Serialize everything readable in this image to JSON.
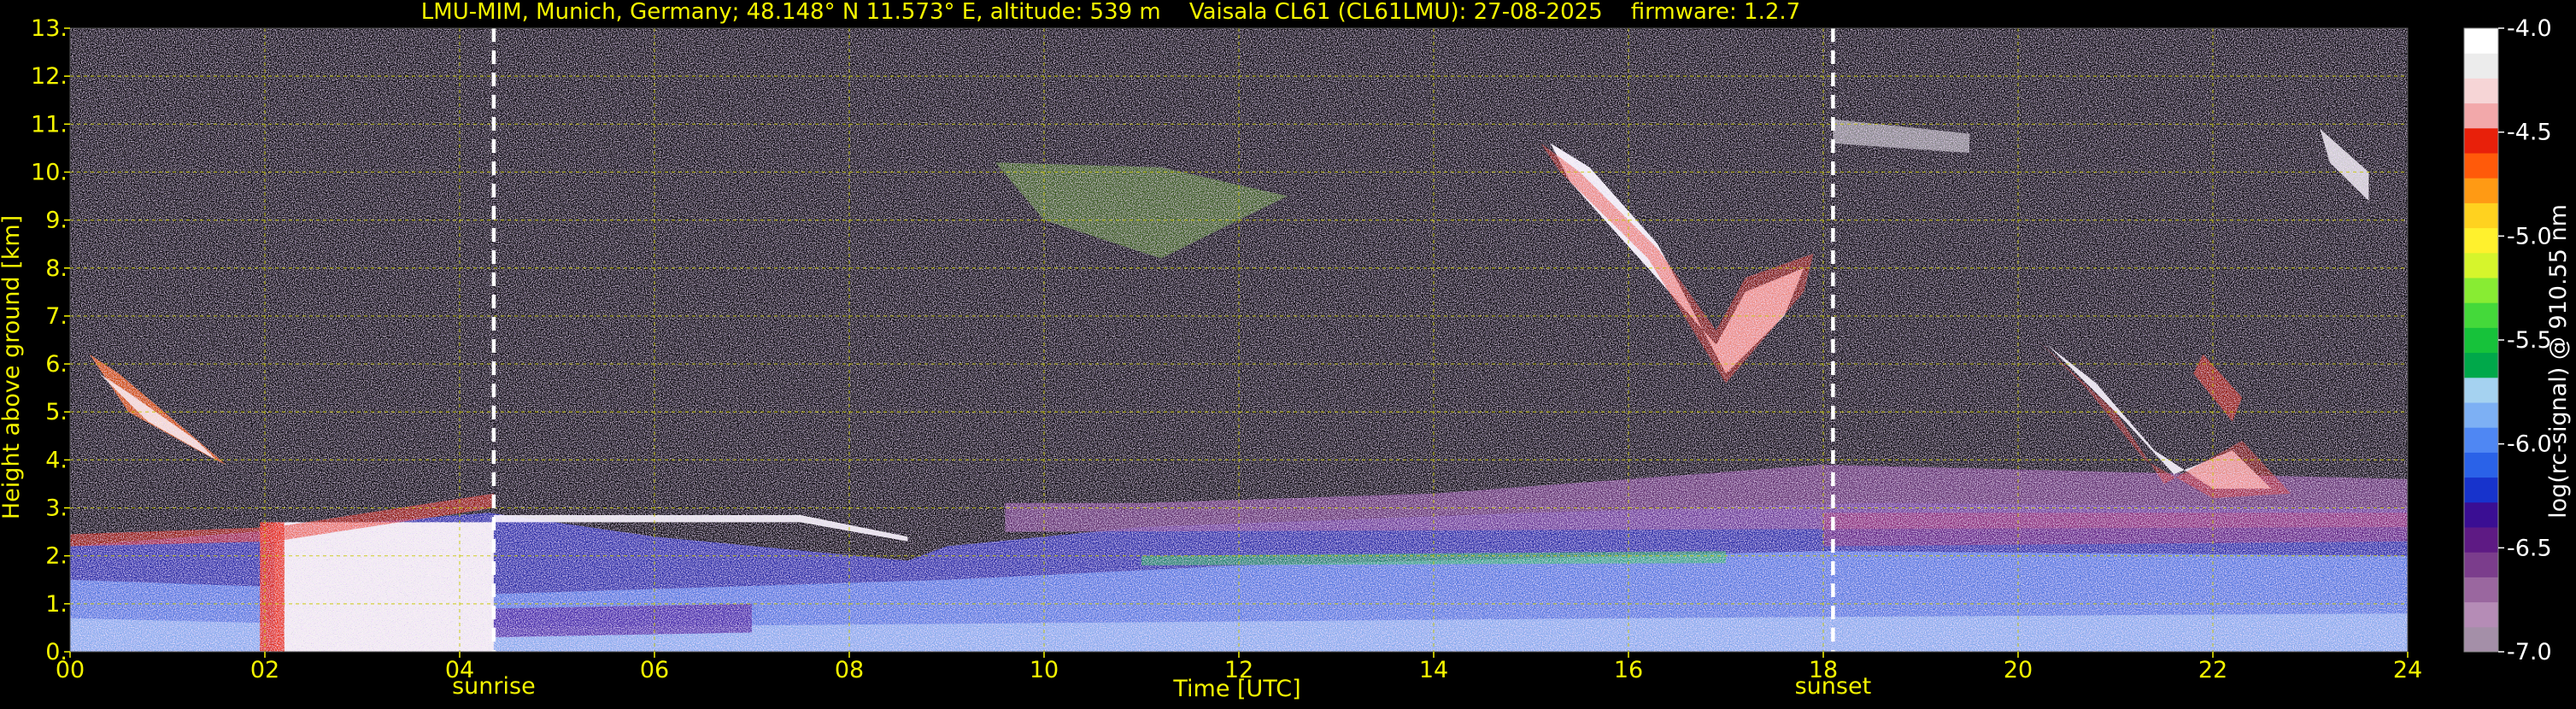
{
  "chart_data": {
    "type": "heatmap",
    "title": "LMU-MIM, Munich, Germany; 48.148° N 11.573° E, altitude: 539 m    Vaisala CL61 (CL61LMU): 27-08-2025    firmware: 1.2.7",
    "xlabel": "Time [UTC]",
    "ylabel": "Height above ground [km]",
    "xlim": [
      0,
      24
    ],
    "ylim": [
      0,
      13
    ],
    "x_ticks": [
      0,
      2,
      4,
      6,
      8,
      10,
      12,
      14,
      16,
      18,
      20,
      22,
      24
    ],
    "x_tick_labels": [
      "00",
      "02",
      "04",
      "06",
      "08",
      "10",
      "12",
      "14",
      "16",
      "18",
      "20",
      "22",
      "24"
    ],
    "y_ticks": [
      0,
      1,
      2,
      3,
      4,
      5,
      6,
      7,
      8,
      9,
      10,
      11,
      12,
      13
    ],
    "y_tick_labels": [
      "0.",
      "1.",
      "2.",
      "3.",
      "4.",
      "5.",
      "6.",
      "7.",
      "8.",
      "9.",
      "10.",
      "11.",
      "12.",
      "13."
    ],
    "grid": true,
    "annotations": [
      {
        "label": "sunrise",
        "time": 4.35
      },
      {
        "label": "sunset",
        "time": 18.1
      }
    ],
    "colorbar": {
      "label": "log(rc-signal) @ 910.55 nm",
      "range": [
        -7.0,
        -4.0
      ],
      "ticks": [
        -4.0,
        -4.5,
        -5.0,
        -5.5,
        -6.0,
        -6.5,
        -7.0
      ],
      "tick_labels": [
        "-4.0",
        "-4.5",
        "-5.0",
        "-5.5",
        "-6.0",
        "-6.5",
        "-7.0"
      ],
      "colors": [
        "#a48fa8",
        "#b58cb6",
        "#9a679f",
        "#7b3d8c",
        "#5e1a84",
        "#3a0e93",
        "#1733cc",
        "#2a62e8",
        "#4f87f3",
        "#7db0f4",
        "#a5d2f0",
        "#00a84a",
        "#16c23a",
        "#44d93a",
        "#88ec33",
        "#d6f52c",
        "#fff12d",
        "#ffd21f",
        "#ff9a14",
        "#ff5a0a",
        "#e8200a",
        "#f2a8aa",
        "#f6d5d6",
        "#ececec",
        "#ffffff"
      ]
    }
  },
  "colors": {
    "background": "#000000",
    "text": "#f5f500",
    "grid": "#c8c800",
    "colorbar_text": "#ffffff",
    "marker_line": "#ffffff"
  }
}
